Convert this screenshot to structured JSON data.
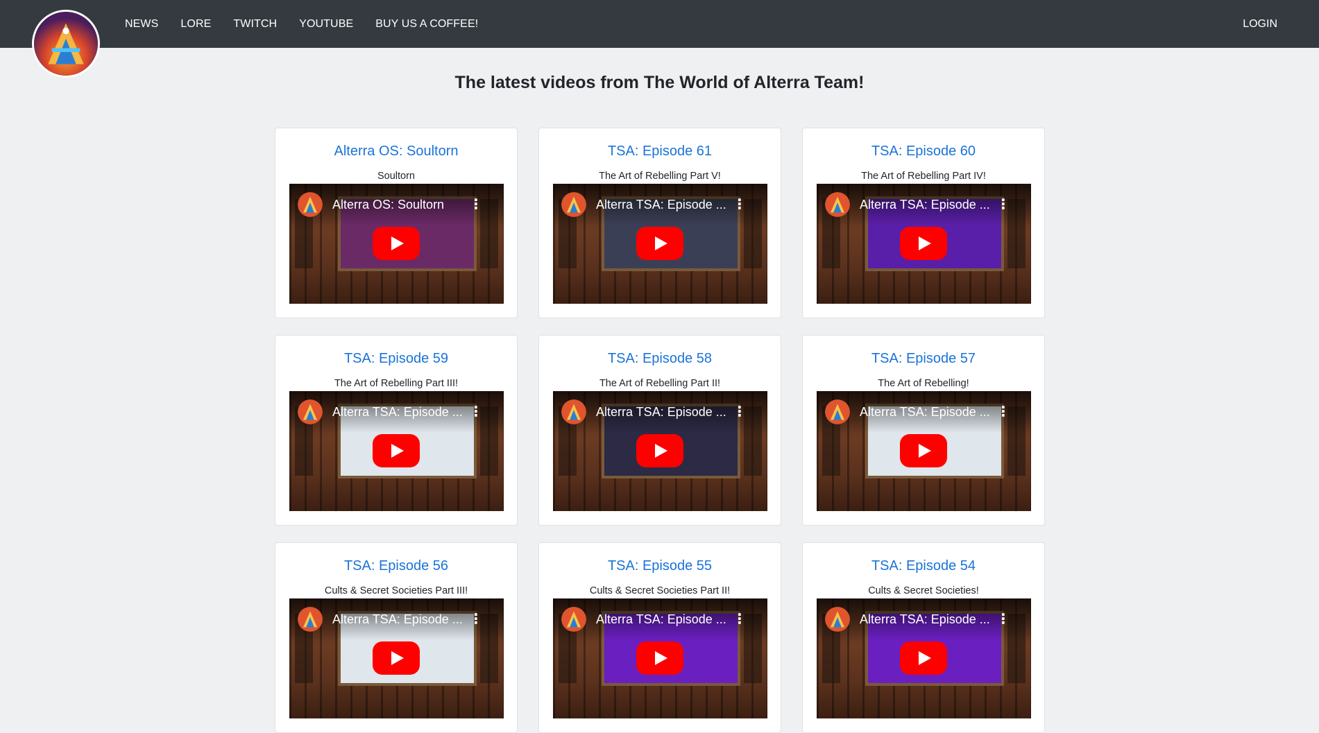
{
  "nav": {
    "links": [
      "NEWS",
      "LORE",
      "TWITCH",
      "YOUTUBE",
      "BUY US A COFFEE!"
    ],
    "login": "LOGIN"
  },
  "page": {
    "title": "The latest videos from The World of Alterra Team!"
  },
  "videos": [
    {
      "title": "Alterra OS: Soultorn",
      "subtitle": "Soultorn",
      "embed_title": "Alterra OS: Soultorn",
      "screen": "#6a2a66"
    },
    {
      "title": "TSA: Episode 61",
      "subtitle": "The Art of Rebelling Part V!",
      "embed_title": "Alterra TSA: Episode ...",
      "screen": "#3b3f55"
    },
    {
      "title": "TSA: Episode 60",
      "subtitle": "The Art of Rebelling Part IV!",
      "embed_title": "Alterra TSA: Episode ...",
      "screen": "#5a1fa8"
    },
    {
      "title": "TSA: Episode 59",
      "subtitle": "The Art of Rebelling Part III!",
      "embed_title": "Alterra TSA: Episode ...",
      "screen": "#dfe6ec"
    },
    {
      "title": "TSA: Episode 58",
      "subtitle": "The Art of Rebelling Part II!",
      "embed_title": "Alterra TSA: Episode ...",
      "screen": "#2c2a44"
    },
    {
      "title": "TSA: Episode 57",
      "subtitle": "The Art of Rebelling!",
      "embed_title": "Alterra TSA: Episode ...",
      "screen": "#dfe6ec"
    },
    {
      "title": "TSA: Episode 56",
      "subtitle": "Cults & Secret Societies Part III!",
      "embed_title": "Alterra TSA: Episode ...",
      "screen": "#dfe6ec"
    },
    {
      "title": "TSA: Episode 55",
      "subtitle": "Cults & Secret Societies Part II!",
      "embed_title": "Alterra TSA: Episode ...",
      "screen": "#6a1fc0"
    },
    {
      "title": "TSA: Episode 54",
      "subtitle": "Cults & Secret Societies!",
      "embed_title": "Alterra TSA: Episode ...",
      "screen": "#6a1fc0"
    }
  ]
}
